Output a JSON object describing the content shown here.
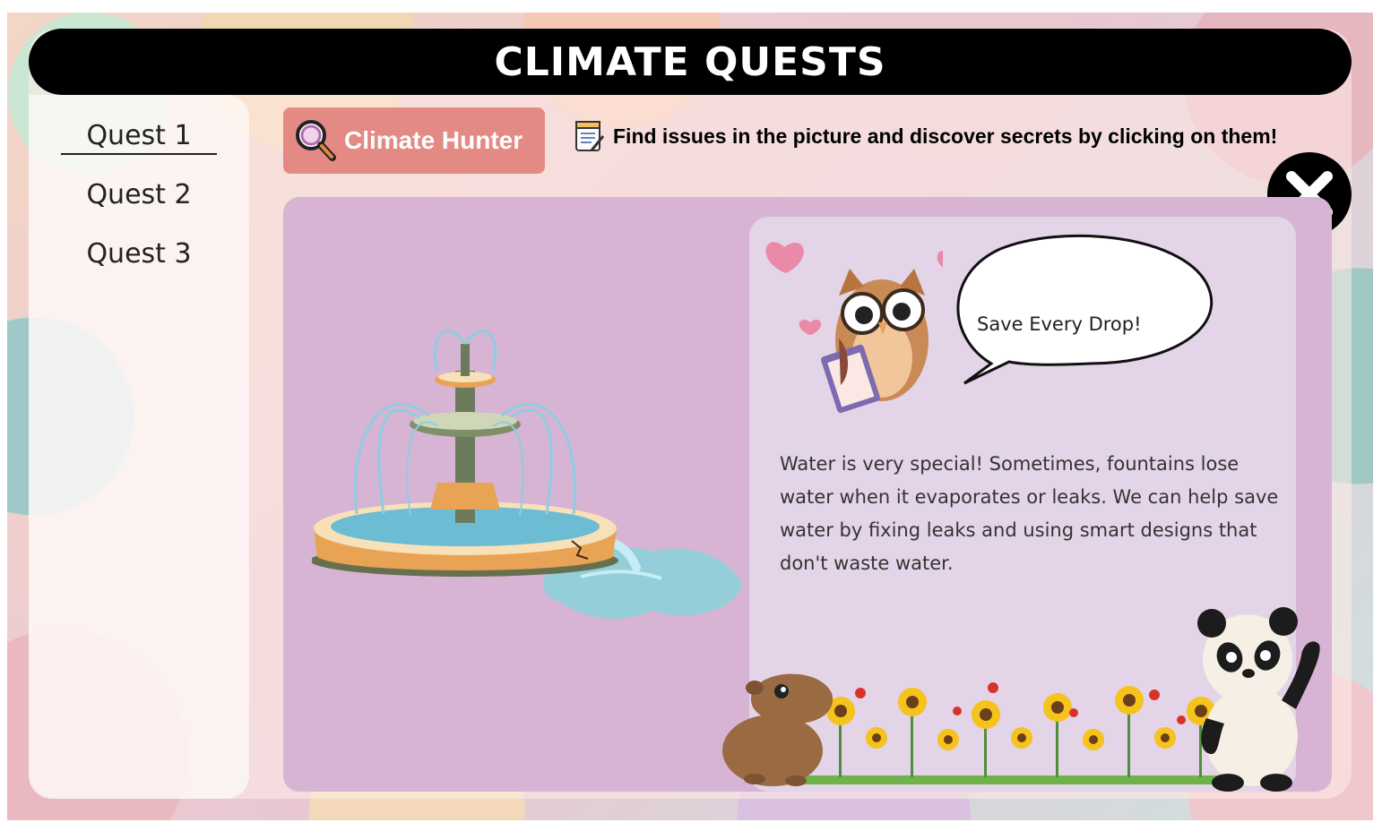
{
  "header": {
    "title": "CLIMATE QUESTS"
  },
  "sidebar": {
    "items": [
      {
        "label": "Quest 1",
        "active": true
      },
      {
        "label": "Quest 2",
        "active": false
      },
      {
        "label": "Quest 3",
        "active": false
      }
    ]
  },
  "toolbar": {
    "mode_button_label": "Climate Hunter",
    "mode_button_icon": "magnifier-icon",
    "instruction_icon": "notepad-icon",
    "instruction_text": "Find issues in the picture and discover secrets by clicking on them!",
    "close_icon": "close-icon"
  },
  "info_card": {
    "speech_text": "Save Every Drop!",
    "description": "Water is very special! Sometimes, fountains lose water when it evaporates or leaks. We can help save water by fixing leaks and using smart designs that don't waste water."
  },
  "colors": {
    "title_bar": "#000000",
    "mode_button": "#e38a85",
    "scene_background": "#d7b4d3",
    "info_card_background": "#e4d4e7"
  }
}
